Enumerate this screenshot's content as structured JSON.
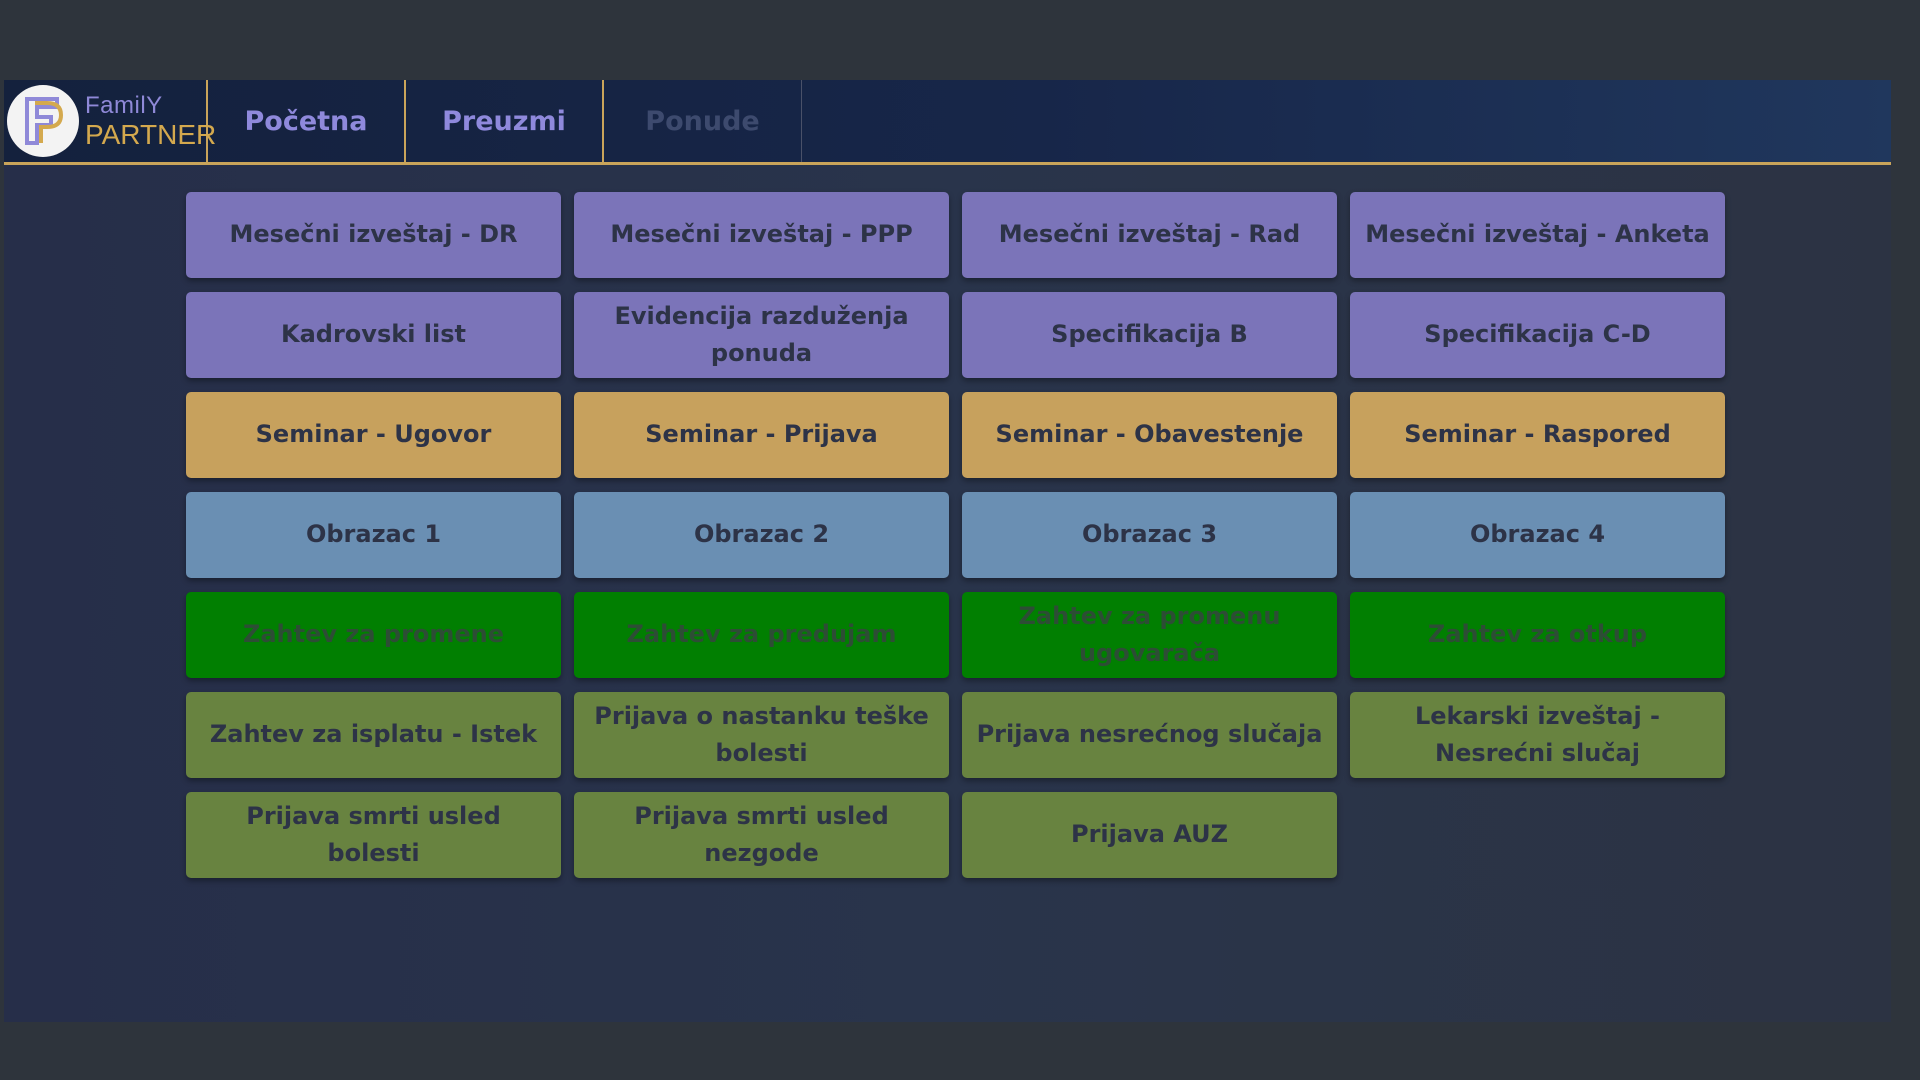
{
  "logo": {
    "top_text": "FamilY",
    "bottom_text": "PARTNER"
  },
  "nav": {
    "tabs": [
      {
        "label": "Početna"
      },
      {
        "label": "Preuzmi"
      },
      {
        "label": "Ponude"
      }
    ]
  },
  "tiles": [
    {
      "label": "Mesečni izveštaj - DR"
    },
    {
      "label": "Mesečni izveštaj - PPP"
    },
    {
      "label": "Mesečni izveštaj - Rad"
    },
    {
      "label": "Mesečni izveštaj - Anketa"
    },
    {
      "label": "Kadrovski list"
    },
    {
      "label": "Evidencija razduženja ponuda"
    },
    {
      "label": "Specifikacija B"
    },
    {
      "label": "Specifikacija C-D"
    },
    {
      "label": "Seminar - Ugovor"
    },
    {
      "label": "Seminar - Prijava"
    },
    {
      "label": "Seminar - Obavestenje"
    },
    {
      "label": "Seminar - Raspored"
    },
    {
      "label": "Obrazac 1"
    },
    {
      "label": "Obrazac 2"
    },
    {
      "label": "Obrazac 3"
    },
    {
      "label": "Obrazac 4"
    },
    {
      "label": "Zahtev za promene"
    },
    {
      "label": "Zahtev za predujam"
    },
    {
      "label": "Zahtev za promenu ugovarača"
    },
    {
      "label": "Zahtev za otkup"
    },
    {
      "label": "Zahtev za isplatu - Istek"
    },
    {
      "label": "Prijava o nastanku teške bolesti"
    },
    {
      "label": "Prijava nesrećnog slučaja"
    },
    {
      "label": "Lekarski izveštaj - Nesrećni slučaj"
    },
    {
      "label": "Prijava smrti usled bolesti"
    },
    {
      "label": "Prijava smrti usled nezgode"
    },
    {
      "label": "Prijava AUZ"
    }
  ],
  "colors": {
    "purple": "#7b74b9",
    "gold": "#c7a15d",
    "blue": "#6a8fb3",
    "green": "#017f01",
    "olive": "#688340",
    "accent": "#c9a45a"
  }
}
